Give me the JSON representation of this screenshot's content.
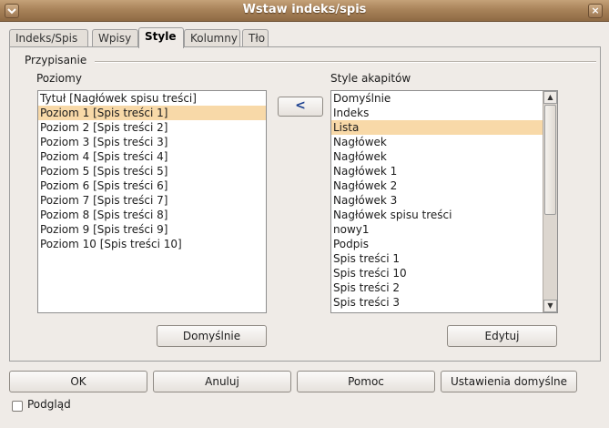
{
  "window": {
    "title": "Wstaw indeks/spis",
    "close_glyph": "×"
  },
  "tabs": [
    {
      "label": "Indeks/Spis",
      "active": false
    },
    {
      "label": "Wpisy",
      "active": false
    },
    {
      "label": "Style",
      "active": true
    },
    {
      "label": "Kolumny",
      "active": false
    },
    {
      "label": "Tło",
      "active": false
    }
  ],
  "assignment": {
    "section_label": "Przypisanie",
    "levels_label": "Poziomy",
    "levels": [
      "Tytuł [Nagłówek spisu treści]",
      "Poziom 1 [Spis treści 1]",
      "Poziom 2 [Spis treści 2]",
      "Poziom 3 [Spis treści 3]",
      "Poziom 4 [Spis treści 4]",
      "Poziom 5 [Spis treści 5]",
      "Poziom 6 [Spis treści 6]",
      "Poziom 7 [Spis treści 7]",
      "Poziom 8 [Spis treści 8]",
      "Poziom 9 [Spis treści 9]",
      "Poziom 10 [Spis treści 10]"
    ],
    "levels_selected_index": 1,
    "assign_arrow": "<",
    "styles_label": "Style akapitów",
    "styles": [
      "Domyślnie",
      "Indeks",
      "Lista",
      "Nagłówek",
      "Nagłówek",
      "Nagłówek 1",
      "Nagłówek 2",
      "Nagłówek 3",
      "Nagłówek spisu treści",
      "nowy1",
      "Podpis",
      "Spis treści 1",
      "Spis treści 10",
      "Spis treści 2",
      "Spis treści 3"
    ],
    "styles_selected_index": 2,
    "default_button": "Domyślnie",
    "edit_button": "Edytuj"
  },
  "footer": {
    "ok": "OK",
    "cancel": "Anuluj",
    "help": "Pomoc",
    "reset_defaults": "Ustawienia domyślne",
    "preview_label": "Podgląd",
    "preview_checked": false
  },
  "colors": {
    "titlebar": "#a9835a",
    "selection": "#f8d9a8",
    "dialog_bg": "#efebe7"
  }
}
